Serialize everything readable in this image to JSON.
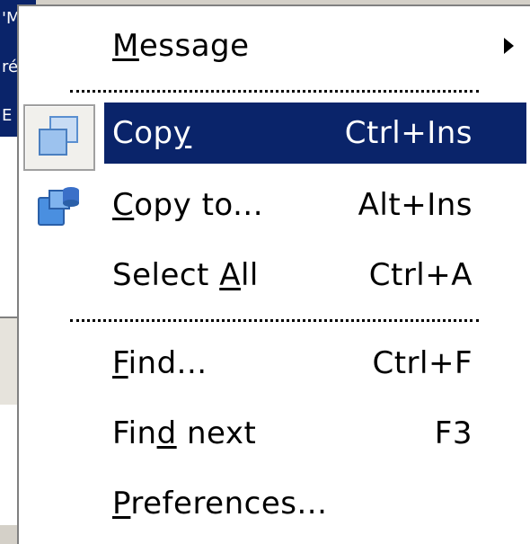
{
  "background": {
    "fragment_lines": [
      "'M",
      "ré",
      "E"
    ]
  },
  "menu": {
    "items": [
      {
        "pre": "",
        "ul": "M",
        "post": "essage",
        "shortcut": "",
        "submenu_icon": "chevron-right-icon"
      },
      {
        "pre": "Cop",
        "ul": "y",
        "post": "",
        "shortcut": "Ctrl+Ins",
        "icon": "copy-icon",
        "selected": true
      },
      {
        "pre": "",
        "ul": "C",
        "post": "opy to...",
        "shortcut": "Alt+Ins",
        "icon": "copy-to-icon"
      },
      {
        "pre": "Select ",
        "ul": "A",
        "post": "ll",
        "shortcut": "Ctrl+A"
      },
      {
        "pre": "",
        "ul": "F",
        "post": "ind...",
        "shortcut": "Ctrl+F"
      },
      {
        "pre": "Fin",
        "ul": "d",
        "post": " next",
        "shortcut": "F3"
      },
      {
        "pre": "",
        "ul": "P",
        "post": "references...",
        "shortcut": ""
      }
    ]
  },
  "colors": {
    "selection": "#0a246a",
    "menu_background": "#ffffff",
    "icon_blue": "#4a8fe0"
  }
}
